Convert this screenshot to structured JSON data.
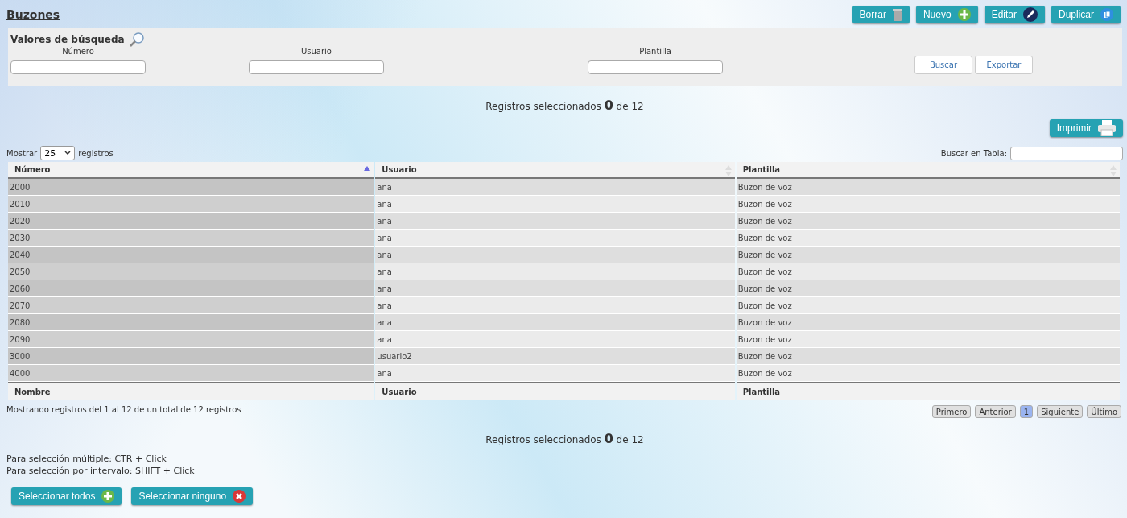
{
  "title": "Buzones",
  "actions": [
    {
      "label": "Borrar",
      "kind": "delete"
    },
    {
      "label": "Nuevo",
      "kind": "add"
    },
    {
      "label": "Editar",
      "kind": "edit"
    },
    {
      "label": "Duplicar",
      "kind": "duplicate"
    }
  ],
  "search": {
    "title": "Valores de búsqueda",
    "fields": [
      {
        "label": "Número"
      },
      {
        "label": "Usuario"
      },
      {
        "label": "Plantilla"
      }
    ],
    "buttons": [
      "Buscar",
      "Exportar"
    ]
  },
  "selected_top": "Registros seleccionados **0** de 12",
  "print_button": "Imprimir",
  "length": {
    "before": "Mostrar",
    "value": "25",
    "after": "registros"
  },
  "filter_label": "Buscar en Tabla:",
  "table": {
    "columns": [
      {
        "label": "Número",
        "sorted": true
      },
      {
        "label": "Usuario",
        "sorted": false
      },
      {
        "label": "Plantilla",
        "sorted": false
      }
    ],
    "rows": [
      [
        "2000",
        "ana",
        "Buzon de voz"
      ],
      [
        "2010",
        "ana",
        "Buzon de voz"
      ],
      [
        "2020",
        "ana",
        "Buzon de voz"
      ],
      [
        "2030",
        "ana",
        "Buzon de voz"
      ],
      [
        "2040",
        "ana",
        "Buzon de voz"
      ],
      [
        "2050",
        "ana",
        "Buzon de voz"
      ],
      [
        "2060",
        "ana",
        "Buzon de voz"
      ],
      [
        "2070",
        "ana",
        "Buzon de voz"
      ],
      [
        "2080",
        "ana",
        "Buzon de voz"
      ],
      [
        "2090",
        "ana",
        "Buzon de voz"
      ],
      [
        "3000",
        "usuario2",
        "Buzon de voz"
      ],
      [
        "4000",
        "ana",
        "Buzon de voz"
      ]
    ],
    "footer": [
      "Nombre",
      "Usuario",
      "Plantilla"
    ]
  },
  "info": "Mostrando registros del 1 al 12 de un total de 12 registros",
  "pagination": [
    {
      "label": "Primero",
      "selected": false
    },
    {
      "label": "Anterior",
      "selected": false
    },
    {
      "label": "1",
      "selected": true
    },
    {
      "label": "Siguiente",
      "selected": false
    },
    {
      "label": "Último",
      "selected": false
    }
  ],
  "selected_bottom": "Registros seleccionados **0** de 12",
  "hints": [
    "Para selección múltiple: CTR + Click",
    "Para selección por intervalo: SHIFT + Click"
  ],
  "select_buttons": [
    {
      "label": "Seleccionar todos",
      "kind": "add"
    },
    {
      "label": "Seleccionar ninguno",
      "kind": "remove"
    }
  ]
}
